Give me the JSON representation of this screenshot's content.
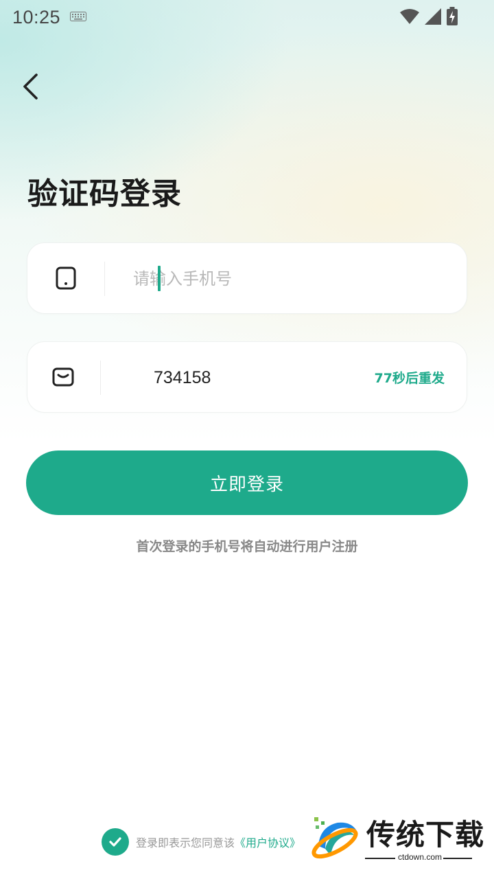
{
  "status_bar": {
    "time": "10:25"
  },
  "page": {
    "title": "验证码登录"
  },
  "phone_field": {
    "placeholder": "请输入手机号",
    "value": ""
  },
  "code_field": {
    "value": "734158",
    "resend_label": "77秒后重发"
  },
  "login_button": {
    "label": "立即登录"
  },
  "hint_text": "首次登录的手机号将自动进行用户注册",
  "agreement": {
    "text": "登录即表示您同意该",
    "link": "《用户协议》",
    "checked": true
  },
  "watermark": {
    "brand": "传统下载",
    "domain": "ctdown.com"
  },
  "colors": {
    "accent": "#1eaa8b",
    "title": "#1a1a1a",
    "hint": "#888888"
  }
}
